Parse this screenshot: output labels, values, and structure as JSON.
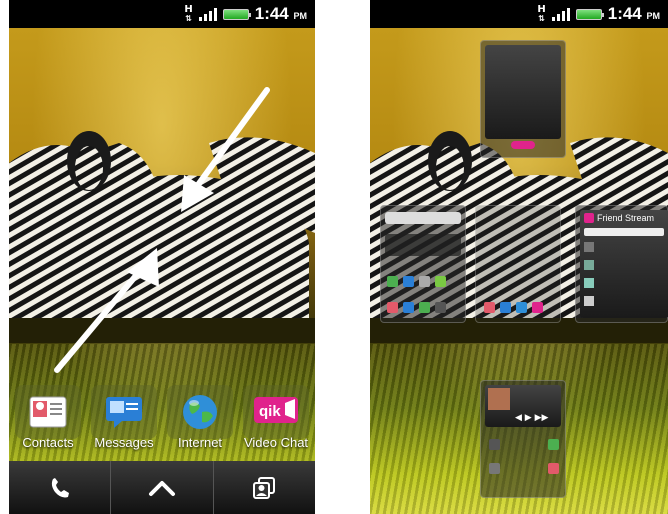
{
  "left_screen": {
    "status": {
      "network": "H",
      "time": "1:44",
      "ampm": "PM"
    },
    "apps": [
      {
        "label": "Contacts",
        "icon": "contacts-icon"
      },
      {
        "label": "Messages",
        "icon": "messages-icon"
      },
      {
        "label": "Internet",
        "icon": "internet-globe-icon"
      },
      {
        "label": "Video Chat",
        "icon": "qik-video-chat-icon",
        "badge": "qik"
      }
    ],
    "dock": [
      {
        "icon": "phone-icon"
      },
      {
        "icon": "chevron-up-icon"
      },
      {
        "icon": "personalize-icon"
      }
    ],
    "annotation_arrows": "white-arrows"
  },
  "right_screen": {
    "status": {
      "network": "H",
      "time": "1:44",
      "ampm": "PM"
    },
    "friend_stream_title": "Friend Stream"
  },
  "colors": {
    "status_bg": "#000000",
    "battery_green": "#21a921",
    "dock_bg": "#1a1a1a",
    "qik_pink": "#e0238c",
    "wallpaper_gold": "#c49a1b",
    "grass_yellow": "#d8d842"
  }
}
